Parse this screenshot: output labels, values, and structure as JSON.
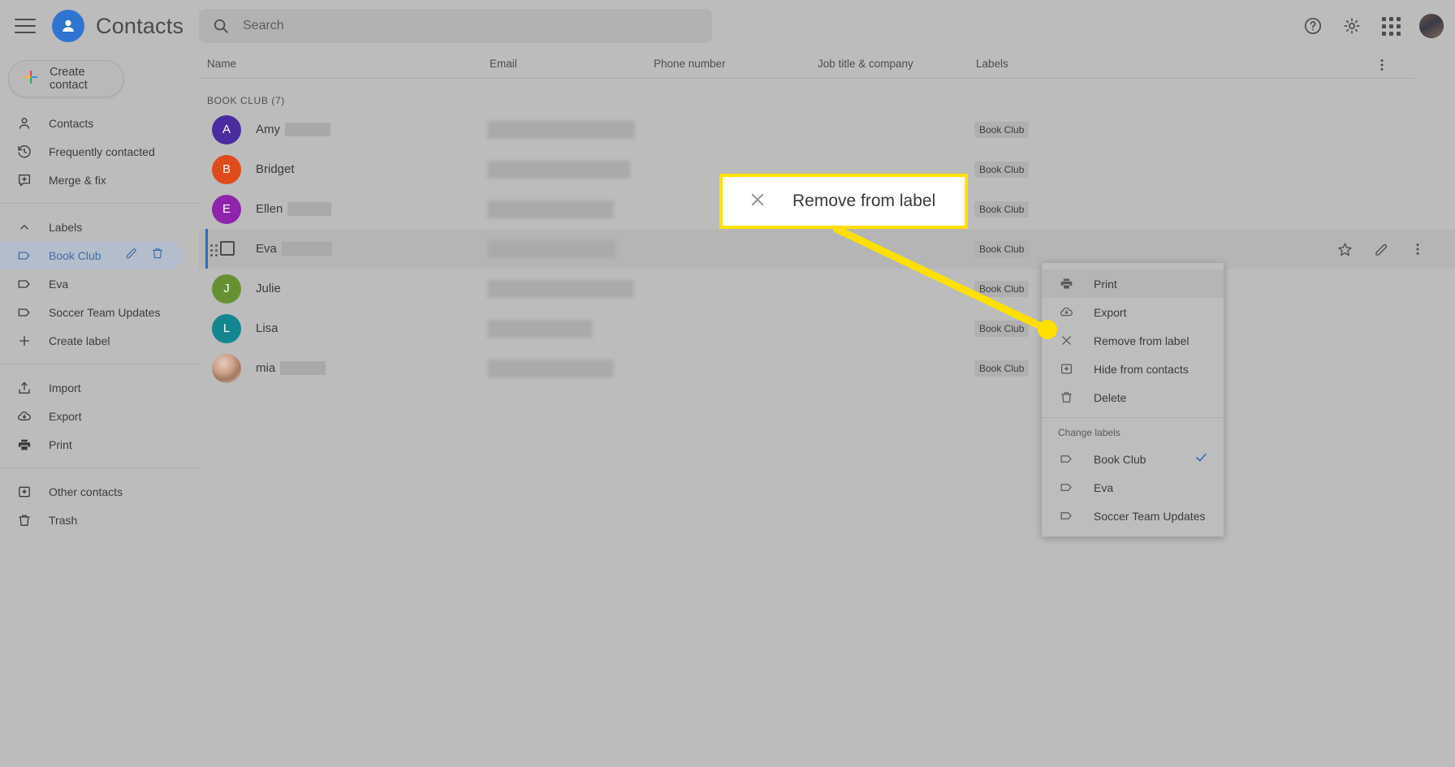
{
  "app": {
    "title": "Contacts",
    "logo_icon": "person-circle-icon",
    "menu_icon": "hamburger-menu-icon"
  },
  "search": {
    "placeholder": "Search",
    "value": "",
    "icon": "search-icon"
  },
  "topbar_actions": [
    {
      "name": "help-icon",
      "label": "Help"
    },
    {
      "name": "settings-gear-icon",
      "label": "Settings"
    },
    {
      "name": "google-apps-grid-icon",
      "label": "Google apps"
    },
    {
      "name": "account-avatar",
      "label": "Account"
    }
  ],
  "sidebar": {
    "create_contact": {
      "label": "Create contact",
      "icon": "plus-multicolor-icon"
    },
    "items": [
      {
        "label": "Contacts",
        "icon": "person-icon",
        "active": false
      },
      {
        "label": "Frequently contacted",
        "icon": "history-clock-icon",
        "active": false
      },
      {
        "label": "Merge & fix",
        "icon": "merge-fix-icon",
        "active": false
      }
    ],
    "labels_header": {
      "label": "Labels",
      "icon": "chevron-up-icon"
    },
    "labels": [
      {
        "label": "Book Club",
        "icon": "label-tag-icon",
        "active": true,
        "edit_icon": "pencil-icon",
        "delete_icon": "trash-icon"
      },
      {
        "label": "Eva",
        "icon": "label-tag-icon",
        "active": false
      },
      {
        "label": "Soccer Team Updates",
        "icon": "label-tag-icon",
        "active": false
      }
    ],
    "create_label": {
      "label": "Create label",
      "icon": "plus-icon"
    },
    "tools": [
      {
        "label": "Import",
        "icon": "import-upload-icon"
      },
      {
        "label": "Export",
        "icon": "export-cloud-download-icon"
      },
      {
        "label": "Print",
        "icon": "printer-icon"
      }
    ],
    "bottom": [
      {
        "label": "Other contacts",
        "icon": "other-contacts-icon"
      },
      {
        "label": "Trash",
        "icon": "trash-icon"
      }
    ]
  },
  "list": {
    "columns": [
      "Name",
      "Email",
      "Phone number",
      "Job title & company",
      "Labels"
    ],
    "more_icon": "more-vertical-icon",
    "group_title": "BOOK CLUB (7)",
    "rows": [
      {
        "name": "Amy",
        "initial": "A",
        "avatar_color": "#4b2ba0",
        "label_chip": "Book Club",
        "selected": false,
        "redacted": true,
        "photo": false
      },
      {
        "name": "Bridget",
        "initial": "B",
        "avatar_color": "#df4b1b",
        "label_chip": "Book Club",
        "selected": false,
        "redacted": false,
        "photo": false
      },
      {
        "name": "Ellen",
        "initial": "E",
        "avatar_color": "#8e24aa",
        "label_chip": "Book Club",
        "selected": false,
        "redacted": true,
        "photo": false
      },
      {
        "name": "Eva",
        "initial": "E",
        "avatar_color": "#8e24aa",
        "label_chip": "Book Club",
        "selected": true,
        "redacted": true,
        "photo": false
      },
      {
        "name": "Julie",
        "initial": "J",
        "avatar_color": "#669132",
        "label_chip": "Book Club",
        "selected": false,
        "redacted": false,
        "photo": false
      },
      {
        "name": "Lisa",
        "initial": "L",
        "avatar_color": "#13868f",
        "label_chip": "Book Club",
        "selected": false,
        "redacted": false,
        "photo": false
      },
      {
        "name": "mia",
        "initial": "",
        "avatar_color": "#d8c4bb",
        "label_chip": "Book Club",
        "selected": false,
        "redacted": true,
        "photo": true
      }
    ],
    "row_actions": [
      {
        "name": "star-icon",
        "label": "Star"
      },
      {
        "name": "pencil-edit-icon",
        "label": "Edit"
      },
      {
        "name": "more-vertical-icon",
        "label": "More actions"
      }
    ]
  },
  "context_menu": {
    "items": [
      {
        "label": "Print",
        "icon": "printer-icon",
        "highlighted": true
      },
      {
        "label": "Export",
        "icon": "export-cloud-download-icon",
        "highlighted": false
      },
      {
        "label": "Remove from label",
        "icon": "close-x-icon",
        "highlighted": false
      },
      {
        "label": "Hide from contacts",
        "icon": "hide-from-contacts-icon",
        "highlighted": false
      },
      {
        "label": "Delete",
        "icon": "trash-icon",
        "highlighted": false
      }
    ],
    "section_title": "Change labels",
    "labels": [
      {
        "label": "Book Club",
        "icon": "label-tag-icon",
        "checked": true,
        "check_icon": "checkmark-icon"
      },
      {
        "label": "Eva",
        "icon": "label-tag-icon",
        "checked": false
      },
      {
        "label": "Soccer Team Updates",
        "icon": "label-tag-icon",
        "checked": false
      }
    ]
  },
  "callout": {
    "label": "Remove from label",
    "icon": "close-x-icon"
  },
  "colors": {
    "highlight_yellow": "#ffe000",
    "accent_blue": "#2f6bbf",
    "brand_blue": "#2f74d0"
  }
}
